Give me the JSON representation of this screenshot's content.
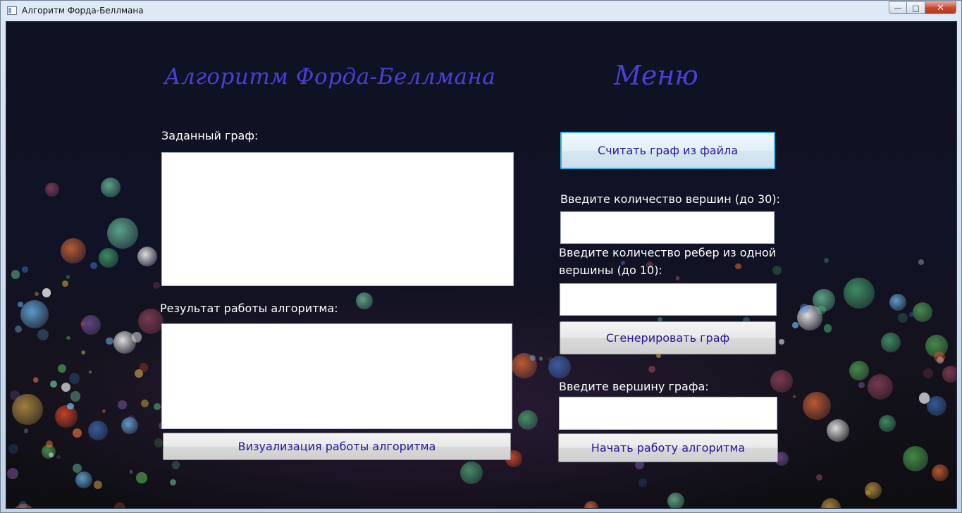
{
  "window": {
    "title": "Алгоритм Форда-Беллмана",
    "controls": {
      "minimize": "—",
      "maximize": "□",
      "close": "✕"
    }
  },
  "main": {
    "heading": "Алгоритм Форда-Беллмана",
    "given_graph_label": "Заданный граф:",
    "given_graph_value": "",
    "result_label": "Результат работы алгоритма:",
    "result_value": "",
    "visualize_button": "Визуализация работы алгоритма"
  },
  "menu": {
    "heading": "Меню",
    "read_file_button": "Считать граф из файла",
    "vertex_count_label": "Введите количество вершин (до 30):",
    "vertex_count_value": "",
    "edge_count_label_line1": "Введите количество ребер из одной",
    "edge_count_label_line2": "вершины (до 10):",
    "edge_count_value": "",
    "generate_button": "Сгенерировать граф",
    "start_vertex_label": "Введите вершину графа:",
    "start_vertex_value": "",
    "start_button": "Начать работу алгоритма"
  },
  "colors": {
    "heading": "#4a3fd8",
    "button_text": "#2a169a",
    "focus_border": "#3db6e6"
  },
  "icons": [
    "app-window-icon",
    "minimize-icon",
    "maximize-icon",
    "close-icon"
  ]
}
